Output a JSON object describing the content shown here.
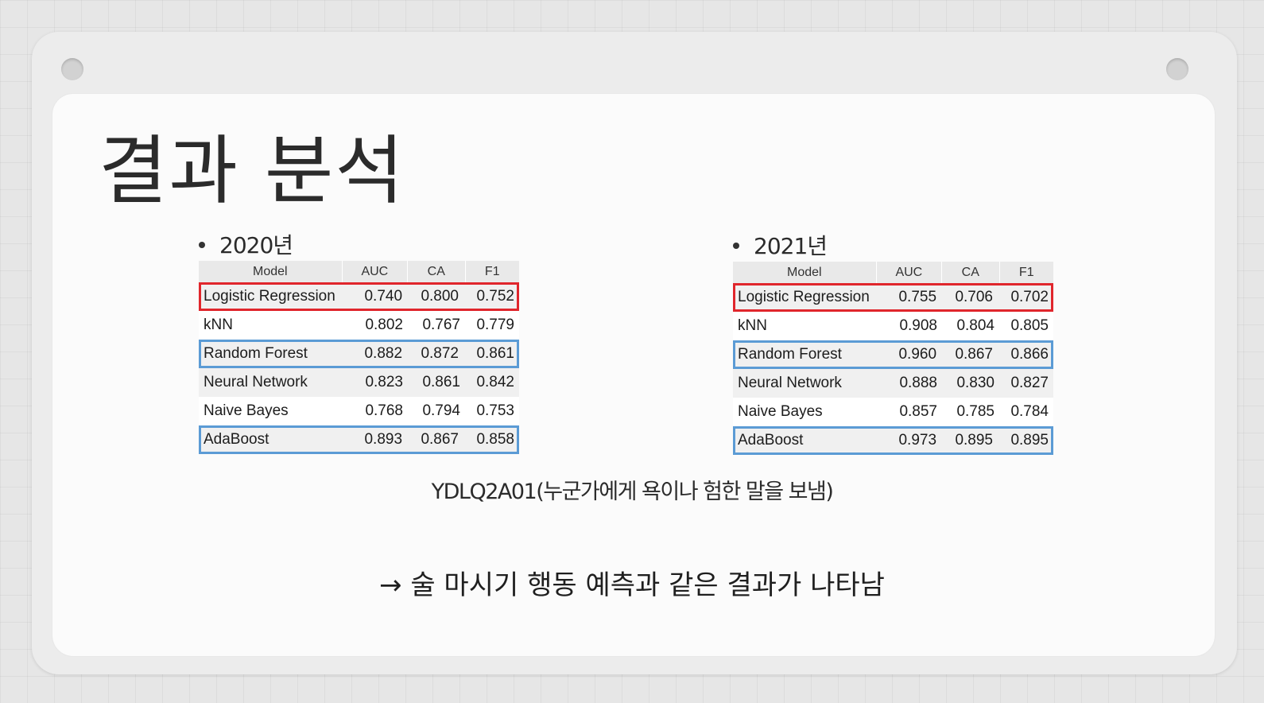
{
  "slide": {
    "title": "결과 분석",
    "caption": "YDLQ2A01(누군가에게 욕이나 험한 말을 보냄)",
    "conclusion": "→ 술 마시기 행동 예측과 같은 결과가 나타남"
  },
  "tables": [
    {
      "year_label": "2020년",
      "headers": {
        "model": "Model",
        "auc": "AUC",
        "ca": "CA",
        "f1": "F1"
      },
      "rows": [
        {
          "model": "Logistic Regression",
          "auc": "0.740",
          "ca": "0.800",
          "f1": "0.752",
          "highlight": "red"
        },
        {
          "model": "kNN",
          "auc": "0.802",
          "ca": "0.767",
          "f1": "0.779",
          "highlight": "none"
        },
        {
          "model": "Random Forest",
          "auc": "0.882",
          "ca": "0.872",
          "f1": "0.861",
          "highlight": "blue"
        },
        {
          "model": "Neural Network",
          "auc": "0.823",
          "ca": "0.861",
          "f1": "0.842",
          "highlight": "none"
        },
        {
          "model": "Naive Bayes",
          "auc": "0.768",
          "ca": "0.794",
          "f1": "0.753",
          "highlight": "none"
        },
        {
          "model": "AdaBoost",
          "auc": "0.893",
          "ca": "0.867",
          "f1": "0.858",
          "highlight": "blue"
        }
      ]
    },
    {
      "year_label": "2021년",
      "headers": {
        "model": "Model",
        "auc": "AUC",
        "ca": "CA",
        "f1": "F1"
      },
      "rows": [
        {
          "model": "Logistic Regression",
          "auc": "0.755",
          "ca": "0.706",
          "f1": "0.702",
          "highlight": "red"
        },
        {
          "model": "kNN",
          "auc": "0.908",
          "ca": "0.804",
          "f1": "0.805",
          "highlight": "none"
        },
        {
          "model": "Random Forest",
          "auc": "0.960",
          "ca": "0.867",
          "f1": "0.866",
          "highlight": "blue"
        },
        {
          "model": "Neural Network",
          "auc": "0.888",
          "ca": "0.830",
          "f1": "0.827",
          "highlight": "none"
        },
        {
          "model": "Naive Bayes",
          "auc": "0.857",
          "ca": "0.785",
          "f1": "0.784",
          "highlight": "none"
        },
        {
          "model": "AdaBoost",
          "auc": "0.973",
          "ca": "0.895",
          "f1": "0.895",
          "highlight": "blue"
        }
      ]
    }
  ],
  "colors": {
    "highlight_red": "#e0262c",
    "highlight_blue": "#5b9bd5",
    "header_bg": "#e9e9e9"
  }
}
